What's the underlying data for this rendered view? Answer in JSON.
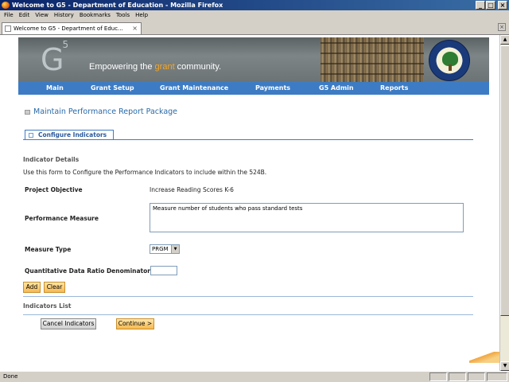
{
  "window": {
    "title": "Welcome to G5 - Department of Education - Mozilla Firefox",
    "buttons": {
      "minimize": "_",
      "maximize": "□",
      "close": "×"
    }
  },
  "menu": [
    {
      "key": "F",
      "rest": "ile"
    },
    {
      "key": "E",
      "rest": "dit"
    },
    {
      "key": "V",
      "rest": "iew"
    },
    {
      "key": "H",
      "rest": "istory",
      "prefix": "Hi",
      "key2": "s",
      "rest2": "tory"
    },
    {
      "key": "B",
      "rest": "ookmarks"
    },
    {
      "key": "T",
      "rest": "ools"
    },
    {
      "key": "H",
      "rest": "elp"
    }
  ],
  "menu_labels": [
    "File",
    "Edit",
    "View",
    "History",
    "Bookmarks",
    "Tools",
    "Help"
  ],
  "tabs": {
    "active_label": "Welcome to G5 - Department of Educ...",
    "close_glyph": "×",
    "right_close_glyph": "×"
  },
  "banner": {
    "logo_text": "G",
    "logo_sup": "5",
    "tagline_start": "Empowering the ",
    "tagline_accent": "grant",
    "tagline_end": " community."
  },
  "nav": [
    "Main",
    "Grant Setup",
    "Grant Maintenance",
    "Payments",
    "G5 Admin",
    "Reports"
  ],
  "page": {
    "heading": "Maintain Performance Report Package",
    "section_tab": "Configure Indicators",
    "indicator_details_head": "Indicator Details",
    "instructions": "Use this form to Configure the Performance Indicators to include within the 524B.",
    "project_objective_label": "Project Objective",
    "project_objective_value": "Increase Reading Scores K-6",
    "performance_measure_label": "Performance Measure",
    "performance_measure_value": "Measure number of students who pass standard tests",
    "measure_type_label": "Measure Type",
    "measure_type_value": "PRGM",
    "quant_label": "Quantitative Data Ratio Denominator",
    "quant_value": "",
    "add_button": "Add",
    "clear_button": "Clear",
    "indicators_list_head": "Indicators List",
    "cancel_button": "Cancel Indicators",
    "continue_button": "Continue >"
  },
  "status": {
    "text": "Done"
  },
  "colors": {
    "nav_blue": "#3d7cc4",
    "heading_blue": "#2a6aa8",
    "button_orange": "#f6b94f"
  }
}
